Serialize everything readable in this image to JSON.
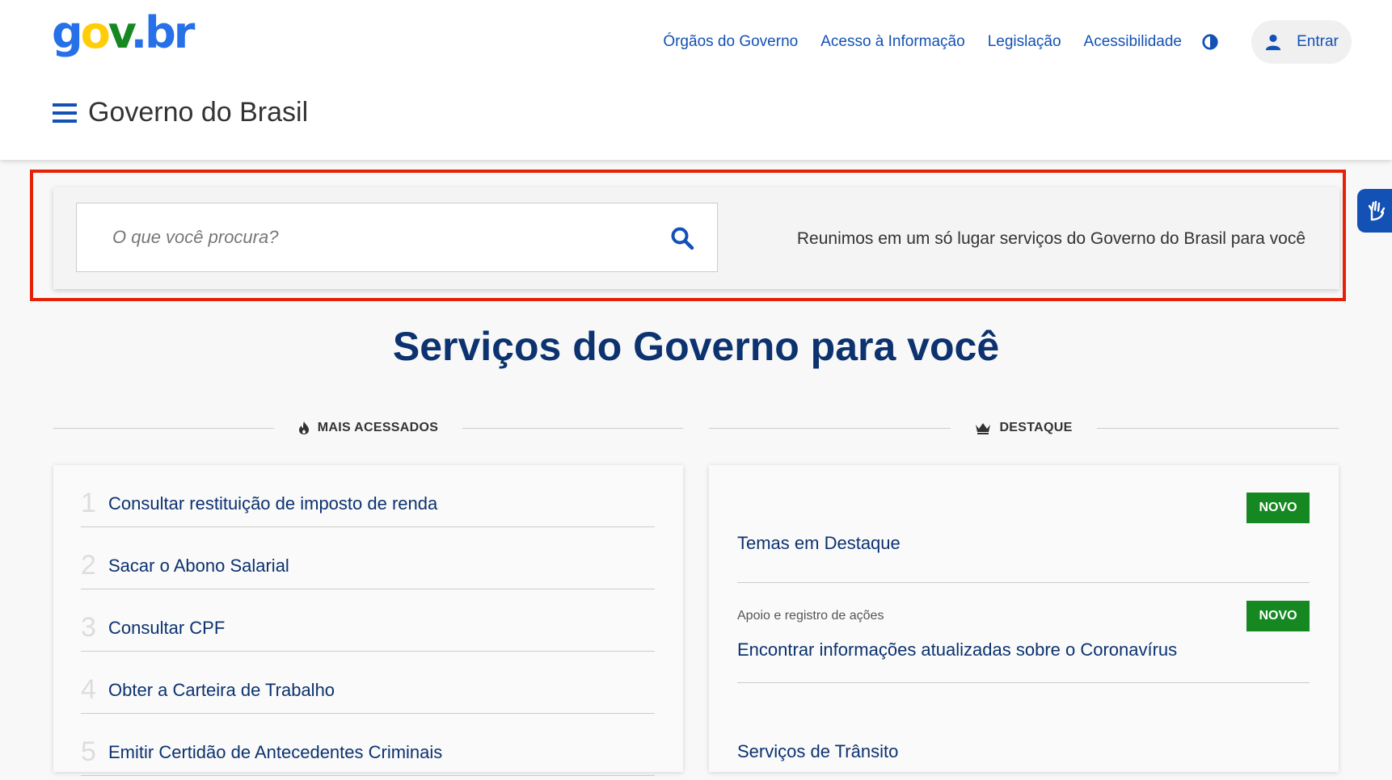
{
  "header": {
    "logo": {
      "g": "g",
      "o": "o",
      "v": "v",
      "dot": ".",
      "br": "br"
    },
    "nav": [
      "Órgãos do Governo",
      "Acesso à Informação",
      "Legislação",
      "Acessibilidade"
    ],
    "login_label": "Entrar",
    "site_title": "Governo do Brasil",
    "colors": {
      "link": "#1351b4",
      "logo_blue": "#2670e8",
      "logo_yellow": "#ffcd07",
      "logo_green": "#168821"
    },
    "icons": [
      "menu-icon",
      "contrast-icon",
      "user-icon"
    ]
  },
  "search": {
    "placeholder": "O que você procura?",
    "value": "",
    "tagline": "Reunimos em um só lugar serviços do Governo do Brasil para você",
    "icon": "search-icon"
  },
  "main": {
    "title": "Serviços do Governo para você",
    "title_color": "#0c326f",
    "most_accessed": {
      "heading": "MAIS ACESSADOS",
      "icon": "flame-icon",
      "items": [
        {
          "num": "1",
          "label": "Consultar restituição de imposto de renda"
        },
        {
          "num": "2",
          "label": "Sacar o Abono Salarial"
        },
        {
          "num": "3",
          "label": "Consultar CPF"
        },
        {
          "num": "4",
          "label": "Obter a Carteira de Trabalho"
        },
        {
          "num": "5",
          "label": "Emitir Certidão de Antecedentes Criminais"
        }
      ]
    },
    "highlights": {
      "heading": "DESTAQUE",
      "icon": "crown-icon",
      "items": [
        {
          "subtitle": "",
          "title": "Temas em Destaque",
          "badge": "NOVO"
        },
        {
          "subtitle": "Apoio e registro de ações",
          "title": "Encontrar informações atualizadas sobre o Coronavírus",
          "badge": "NOVO"
        },
        {
          "subtitle": "",
          "title": "Serviços de Trânsito",
          "badge": ""
        }
      ],
      "badge_color": "#168821"
    }
  },
  "side_widget": {
    "icon": "sign-language-icon"
  }
}
